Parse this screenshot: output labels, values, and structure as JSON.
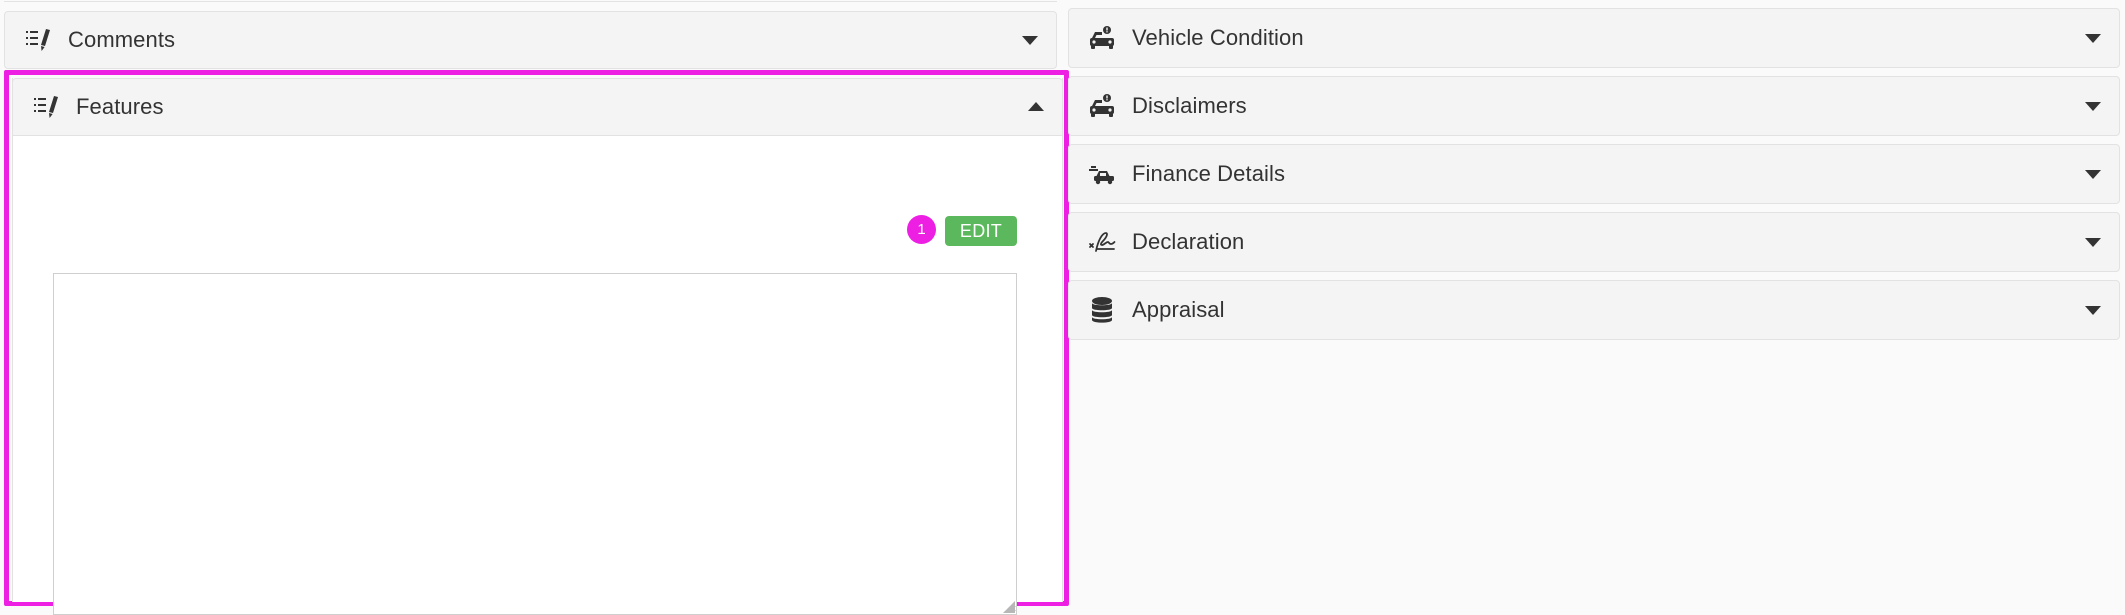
{
  "left_panels": {
    "comments": {
      "label": "Comments",
      "icon": "list-pencil-icon",
      "state": "collapsed"
    },
    "features": {
      "label": "Features",
      "icon": "list-pencil-icon",
      "state": "expanded",
      "badge": "1",
      "edit_label": "EDIT",
      "textarea_value": ""
    }
  },
  "right_panels": [
    {
      "label": "Vehicle Condition",
      "icon": "car-alert-icon",
      "state": "collapsed"
    },
    {
      "label": "Disclaimers",
      "icon": "car-alert-icon",
      "state": "collapsed"
    },
    {
      "label": "Finance Details",
      "icon": "car-finance-icon",
      "state": "collapsed"
    },
    {
      "label": "Declaration",
      "icon": "signature-icon",
      "state": "collapsed"
    },
    {
      "label": "Appraisal",
      "icon": "database-icon",
      "state": "collapsed"
    }
  ],
  "colors": {
    "highlight": "#ec1fe3",
    "edit_button": "#5cb85c",
    "header_bg": "#f4f4f4"
  }
}
